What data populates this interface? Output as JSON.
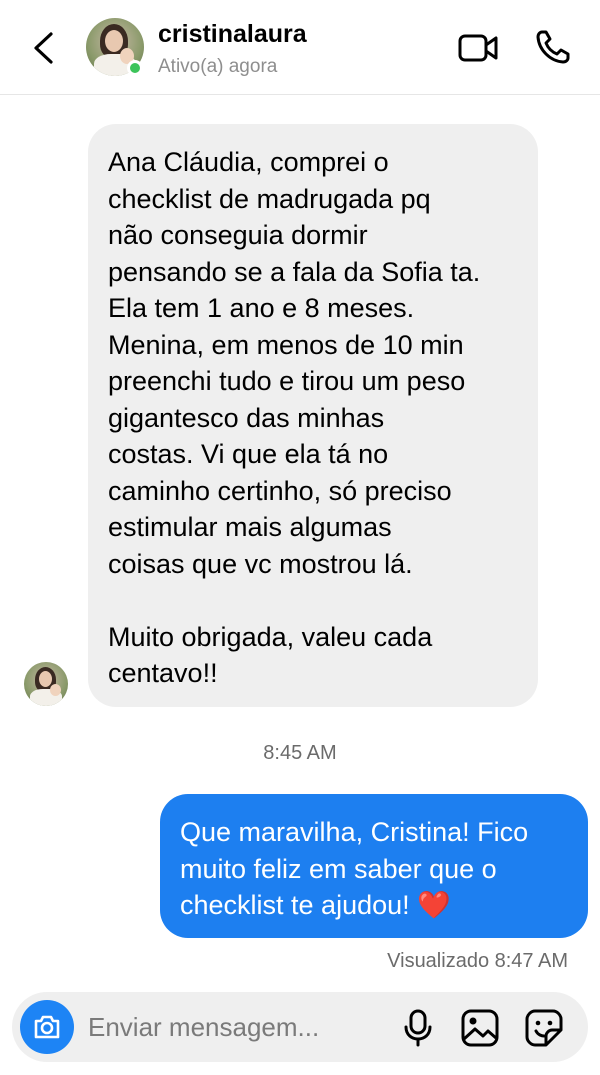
{
  "header": {
    "username": "cristinalaura",
    "status": "Ativo(a) agora",
    "icons": [
      "back-arrow-icon",
      "video-camera-icon",
      "phone-icon"
    ]
  },
  "messages": [
    {
      "direction": "incoming",
      "text": "Ana Cláudia, comprei o\nchecklist de madrugada pq\nnão conseguia dormir\npensando se a fala da Sofia ta.\nEla tem 1 ano e 8 meses.\nMenina, em menos de 10 min\npreenchi tudo e tirou um peso\ngigantesco das minhas\ncostas. Vi que ela tá no\ncaminho certinho, só preciso\nestimular mais algumas\ncoisas que vc mostrou lá.\n\nMuito obrigada, valeu cada\ncentavo!!"
    },
    {
      "direction": "outgoing",
      "text": "Que maravilha, Cristina! Fico muito feliz em saber que o checklist te ajudou!",
      "emoji": "❤️"
    }
  ],
  "timestamp": "8:45 AM",
  "seen_status": "Visualizado 8:47 AM",
  "composer": {
    "placeholder": "Enviar mensagem...",
    "icons": [
      "camera-icon",
      "microphone-icon",
      "gallery-icon",
      "sticker-icon"
    ]
  },
  "colors": {
    "outgoing_bubble": "#1d7ff0",
    "incoming_bubble": "#efefef",
    "online_dot": "#3cc45a",
    "camera_button": "#1d84f5"
  }
}
